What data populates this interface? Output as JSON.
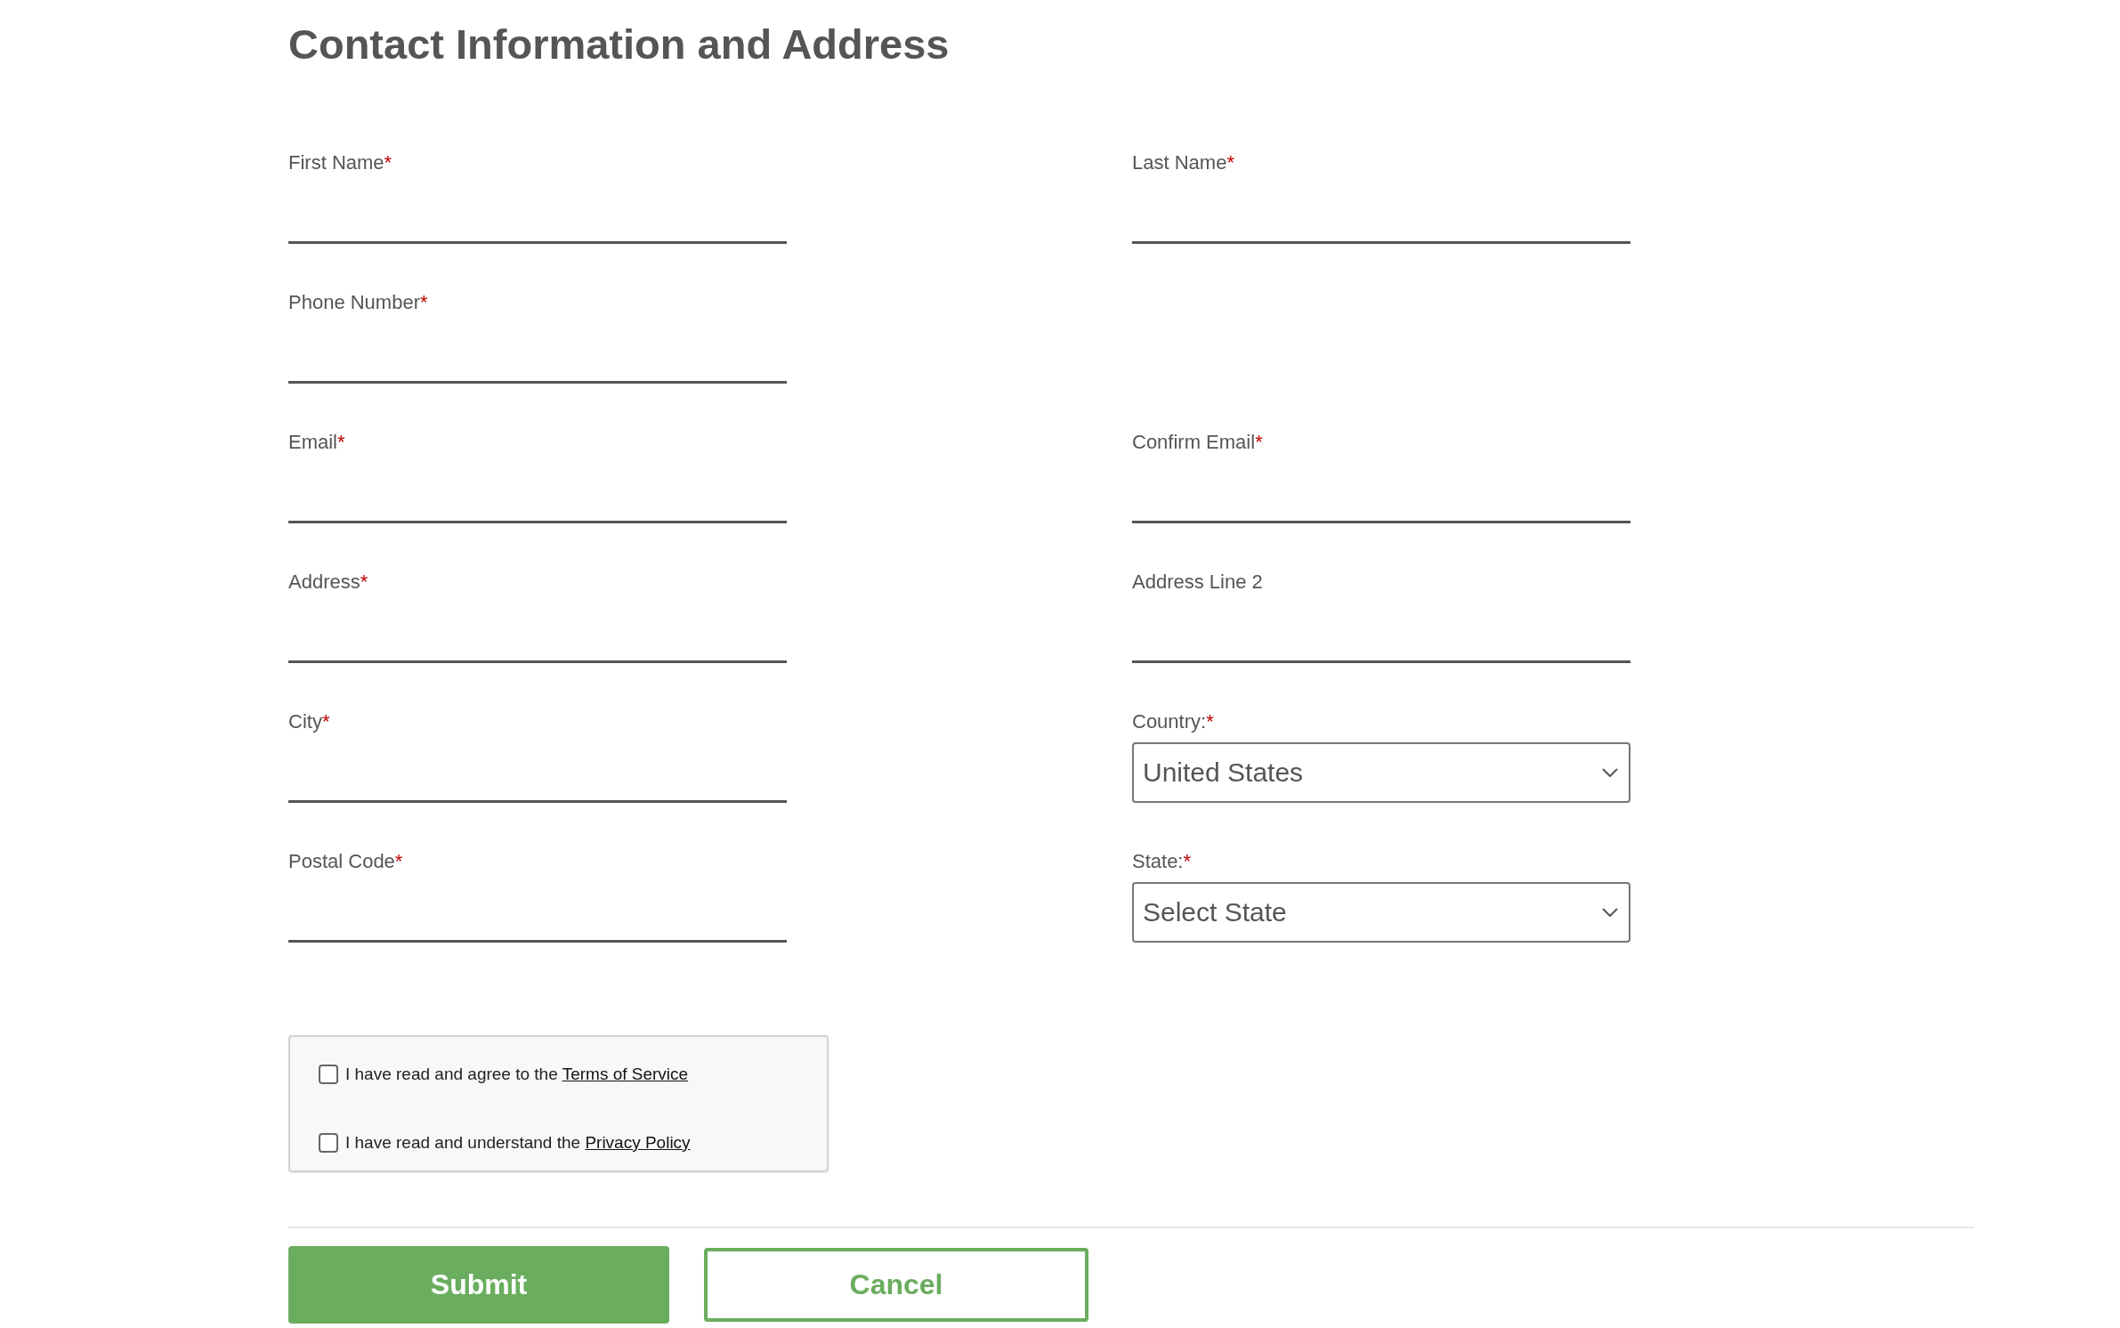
{
  "title": "Contact Information and Address",
  "rows": [
    {
      "left": {
        "kind": "text",
        "label": "First Name",
        "required_mark": "*"
      },
      "right": {
        "kind": "text",
        "label": "Last Name",
        "required_mark": "*"
      }
    },
    {
      "left": {
        "kind": "text",
        "label": "Phone Number",
        "required_mark": "*"
      }
    },
    {
      "left": {
        "kind": "text",
        "label": "Email",
        "required_mark": "*"
      },
      "right": {
        "kind": "text",
        "label": "Confirm Email",
        "required_mark": "*"
      }
    },
    {
      "left": {
        "kind": "text",
        "label": "Address",
        "required_mark": "*"
      },
      "right": {
        "kind": "text",
        "label": "Address Line 2"
      }
    },
    {
      "left": {
        "kind": "text",
        "label": "City",
        "required_mark": "*"
      },
      "right": {
        "kind": "select",
        "label": "Country:",
        "required_mark": "*",
        "value": "United States"
      }
    },
    {
      "left": {
        "kind": "text",
        "label": "Postal Code",
        "required_mark": "*"
      },
      "right": {
        "kind": "select",
        "label": "State:",
        "required_mark": "*",
        "value": "Select State"
      }
    }
  ],
  "agreements": [
    {
      "text": "I have read and agree to the",
      "link": "Terms of Service",
      "checked": false
    },
    {
      "text": "I have read and understand the",
      "link": "Privacy Policy",
      "checked": false
    }
  ],
  "buttons": [
    {
      "label": "Submit",
      "kind": "primary"
    },
    {
      "label": "Cancel",
      "kind": "secondary"
    }
  ]
}
